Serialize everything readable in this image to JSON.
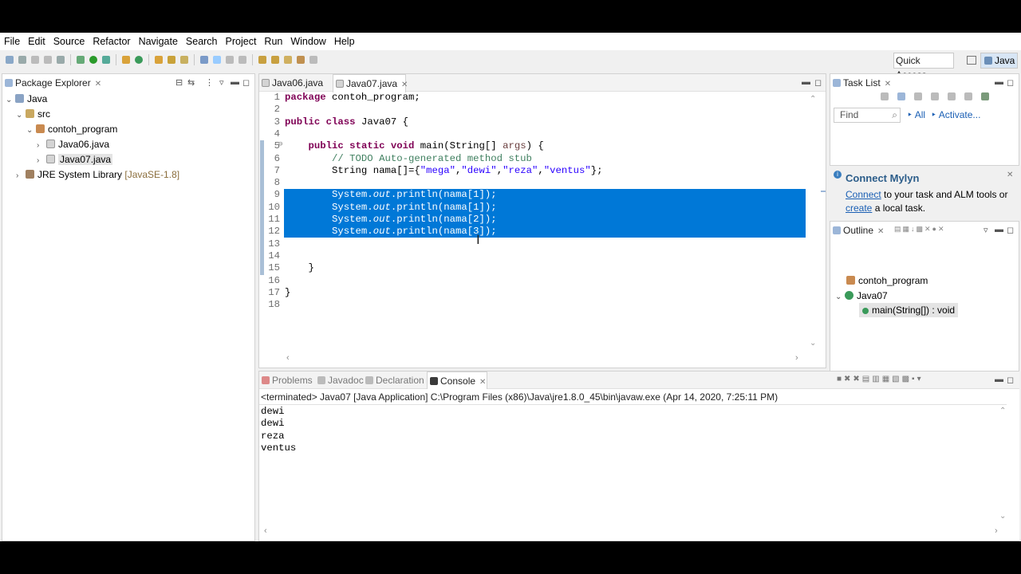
{
  "menu": [
    "File",
    "Edit",
    "Source",
    "Refactor",
    "Navigate",
    "Search",
    "Project",
    "Run",
    "Window",
    "Help"
  ],
  "quick_access": "Quick Access",
  "perspective": "Java",
  "package_explorer": {
    "title": "Package Explorer",
    "tree": [
      {
        "label": "Java",
        "extra": ""
      },
      {
        "label": "src",
        "extra": ""
      },
      {
        "label": "contoh_program",
        "extra": ""
      },
      {
        "label": "Java06.java",
        "extra": ""
      },
      {
        "label": "Java07.java",
        "extra": ""
      },
      {
        "label": "JRE System Library",
        "extra": "[JavaSE-1.8]"
      }
    ]
  },
  "editor": {
    "tabs": [
      {
        "label": "Java06.java"
      },
      {
        "label": "Java07.java"
      }
    ],
    "line_numbers": [
      "1",
      "2",
      "3",
      "4",
      "5",
      "6",
      "7",
      "8",
      "9",
      "10",
      "11",
      "12",
      "13",
      "14",
      "15",
      "16",
      "17",
      "18"
    ],
    "code": {
      "l1_kw": "package",
      "l1_rest": " contoh_program;",
      "l3_kw": "public class",
      "l3_rest": " Java07 {",
      "l5_pre": "    ",
      "l5_kw": "public static void",
      "l5_rest": " main(String[] ",
      "l5_arg": "args",
      "l5_end": ") {",
      "l6": "        // TODO Auto-generated method stub",
      "l7_pre": "        String nama[]={",
      "l7_s1": "\"mega\"",
      "l7_s2": "\"dewi\"",
      "l7_s3": "\"reza\"",
      "l7_s4": "\"ventus\"",
      "l7_end": "};",
      "sys": "        System.",
      "out": "out",
      "l9_rest": ".println(nama[1]);",
      "l10_rest": ".println(nama[1]);",
      "l11_rest": ".println(nama[2]);",
      "l12_rest": ".println(nama[3]);",
      "l15": "    }",
      "l17": "}"
    }
  },
  "task_list": {
    "title": "Task List",
    "find_placeholder": "Find",
    "all": "All",
    "activate": "Activate..."
  },
  "mylyn": {
    "title": "Connect Mylyn",
    "connect": "Connect",
    "text1": " to your task and ALM tools or",
    "create": "create",
    "text2": " a local task."
  },
  "outline": {
    "title": "Outline",
    "items": [
      "contoh_program",
      "Java07",
      "main(String[]) : void"
    ]
  },
  "bottom_tabs": [
    "Problems",
    "Javadoc",
    "Declaration",
    "Console"
  ],
  "console": {
    "header": "<terminated> Java07 [Java Application] C:\\Program Files (x86)\\Java\\jre1.8.0_45\\bin\\javaw.exe (Apr 14, 2020, 7:25:11 PM)",
    "lines": [
      "dewi",
      "dewi",
      "reza",
      "ventus"
    ]
  },
  "colors": {
    "selection": "#0078d7",
    "keyword": "#7f0055",
    "comment": "#3f7f5f",
    "string": "#2a00ff",
    "field": "#0000c0"
  }
}
